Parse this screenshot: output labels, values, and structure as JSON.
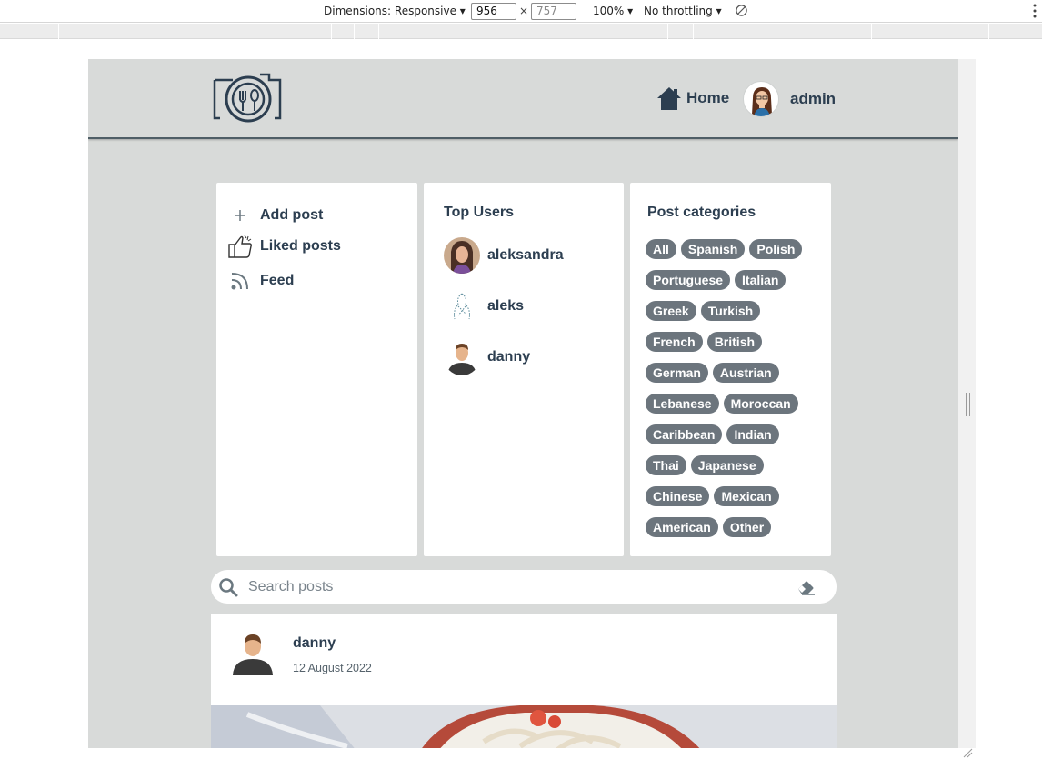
{
  "devtools": {
    "dimensions_label": "Dimensions: Responsive ▾",
    "width": "956",
    "height": "757",
    "times": "×",
    "zoom": "100% ▾",
    "throttling": "No throttling ▾"
  },
  "colors": {
    "page_bg": "#d8dad9",
    "text": "#2c3e50",
    "tag_bg": "#6c757d",
    "card_bg": "#ffffff",
    "nav_border": "#4f5e66"
  },
  "nav": {
    "logo_icon": "camera-plate-logo",
    "home_icon": "house-icon",
    "home_label": "Home",
    "user_label": "admin"
  },
  "menu": {
    "items": [
      {
        "icon": "plus-icon",
        "label": "Add post"
      },
      {
        "icon": "thumbs-up-icon",
        "label": "Liked posts"
      },
      {
        "icon": "rss-icon",
        "label": "Feed"
      }
    ]
  },
  "top_users": {
    "title": "Top Users",
    "users": [
      {
        "name": "aleksandra"
      },
      {
        "name": "aleks"
      },
      {
        "name": "danny"
      }
    ]
  },
  "categories": {
    "title": "Post categories",
    "tags": [
      "All",
      "Spanish",
      "Polish",
      "Portuguese",
      "Italian",
      "Greek",
      "Turkish",
      "French",
      "British",
      "German",
      "Austrian",
      "Lebanese",
      "Moroccan",
      "Caribbean",
      "Indian",
      "Thai",
      "Japanese",
      "Chinese",
      "Mexican",
      "American",
      "Other"
    ]
  },
  "search": {
    "placeholder": "Search posts"
  },
  "post": {
    "author": "danny",
    "date": "12 August 2022"
  }
}
